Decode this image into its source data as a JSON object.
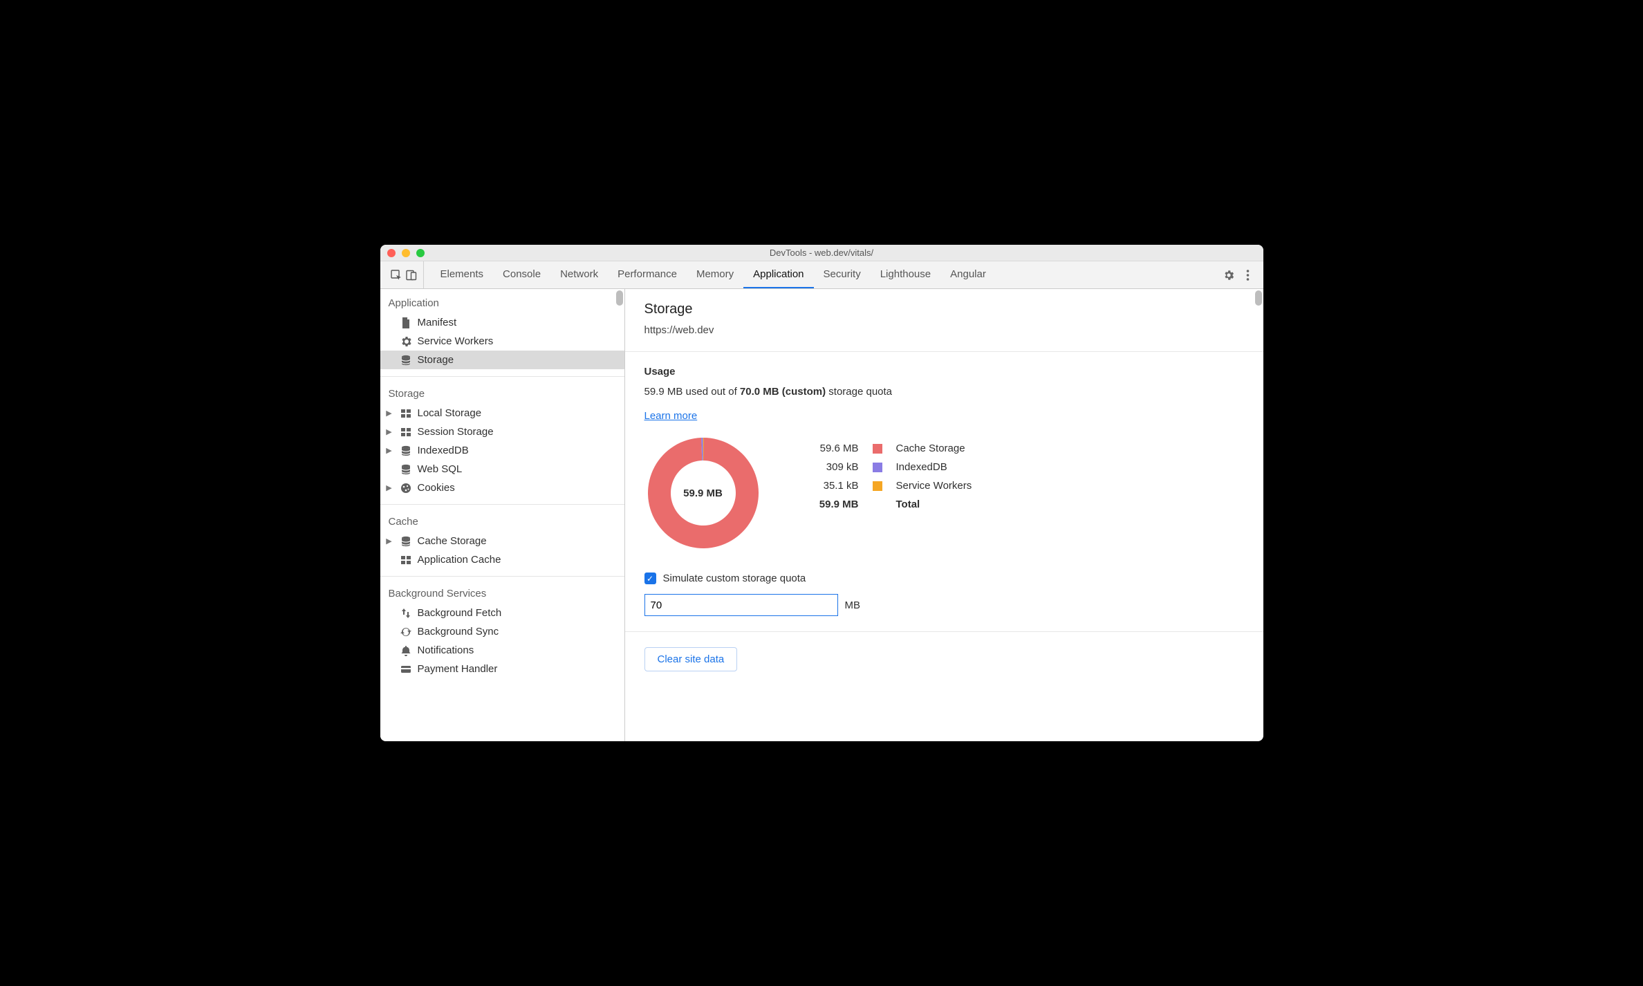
{
  "window": {
    "title": "DevTools - web.dev/vitals/"
  },
  "tabs": {
    "items": [
      "Elements",
      "Console",
      "Network",
      "Performance",
      "Memory",
      "Application",
      "Security",
      "Lighthouse",
      "Angular"
    ],
    "active": "Application"
  },
  "sidebar": {
    "sections": [
      {
        "title": "Application",
        "items": [
          {
            "label": "Manifest",
            "icon": "file",
            "expandable": false
          },
          {
            "label": "Service Workers",
            "icon": "gear",
            "expandable": false
          },
          {
            "label": "Storage",
            "icon": "db",
            "expandable": false,
            "selected": true
          }
        ]
      },
      {
        "title": "Storage",
        "items": [
          {
            "label": "Local Storage",
            "icon": "grid",
            "expandable": true
          },
          {
            "label": "Session Storage",
            "icon": "grid",
            "expandable": true
          },
          {
            "label": "IndexedDB",
            "icon": "db",
            "expandable": true
          },
          {
            "label": "Web SQL",
            "icon": "db",
            "expandable": false
          },
          {
            "label": "Cookies",
            "icon": "cookie",
            "expandable": true
          }
        ]
      },
      {
        "title": "Cache",
        "items": [
          {
            "label": "Cache Storage",
            "icon": "db",
            "expandable": true
          },
          {
            "label": "Application Cache",
            "icon": "grid",
            "expandable": false
          }
        ]
      },
      {
        "title": "Background Services",
        "items": [
          {
            "label": "Background Fetch",
            "icon": "updown",
            "expandable": false
          },
          {
            "label": "Background Sync",
            "icon": "sync",
            "expandable": false
          },
          {
            "label": "Notifications",
            "icon": "bell",
            "expandable": false
          },
          {
            "label": "Payment Handler",
            "icon": "card",
            "expandable": false
          }
        ]
      }
    ]
  },
  "storage": {
    "heading": "Storage",
    "origin": "https://web.dev",
    "usage": {
      "heading": "Usage",
      "line_prefix": "59.9 MB used out of ",
      "quota_bold": "70.0 MB (custom)",
      "line_suffix": " storage quota",
      "learn_more": "Learn more",
      "total_display": "59.9 MB",
      "total_label": "Total",
      "legend": [
        {
          "size": "59.6 MB",
          "name": "Cache Storage",
          "color": "#ea6c6c"
        },
        {
          "size": "309 kB",
          "name": "IndexedDB",
          "color": "#8a7ce4"
        },
        {
          "size": "35.1 kB",
          "name": "Service Workers",
          "color": "#f5a623"
        }
      ]
    },
    "simulate": {
      "label": "Simulate custom storage quota",
      "checked": true,
      "value": "70",
      "unit": "MB"
    },
    "clear_button": "Clear site data"
  },
  "chart_data": {
    "type": "pie",
    "title": "Storage usage",
    "unit": "MB",
    "total": 59.9,
    "quota": 70.0,
    "series": [
      {
        "name": "Cache Storage",
        "value": 59.6,
        "color": "#ea6c6c"
      },
      {
        "name": "IndexedDB",
        "value": 0.309,
        "color": "#8a7ce4"
      },
      {
        "name": "Service Workers",
        "value": 0.0351,
        "color": "#f5a623"
      }
    ],
    "center_label": "59.9 MB"
  }
}
